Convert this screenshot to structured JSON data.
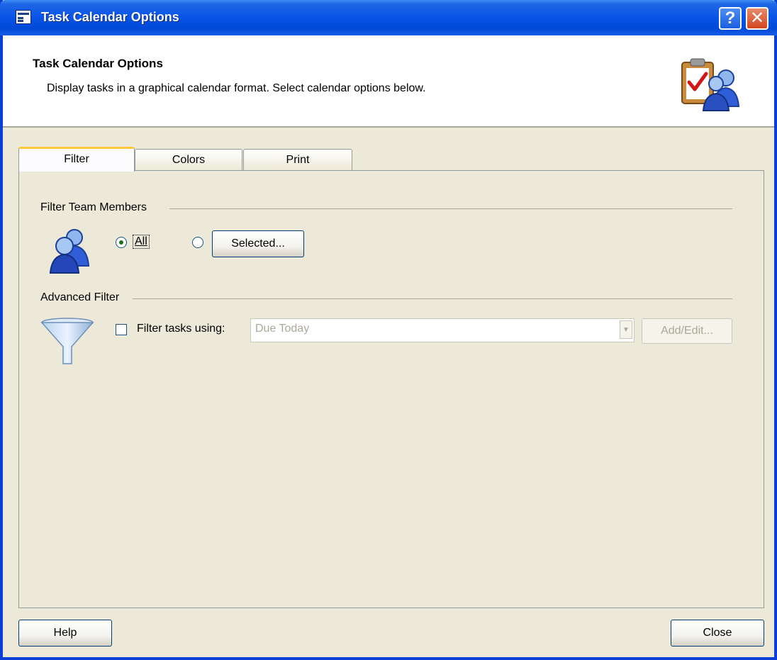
{
  "window": {
    "title": "Task Calendar Options",
    "help_button": "?",
    "close_button": "✕"
  },
  "header": {
    "title": "Task Calendar Options",
    "subtitle": "Display tasks in a graphical calendar format. Select calendar options below.",
    "icon": "clipboard-people-icon"
  },
  "tabs": [
    {
      "label": "Filter",
      "active": true
    },
    {
      "label": "Colors",
      "active": false
    },
    {
      "label": "Print",
      "active": false
    }
  ],
  "filter_team": {
    "label": "Filter Team Members",
    "icon": "team-members-icon",
    "option_all": "All",
    "option_all_selected": true,
    "option_selected_button": "Selected..."
  },
  "advanced_filter": {
    "label": "Advanced Filter",
    "icon": "funnel-icon",
    "checkbox_label": "Filter tasks using:",
    "checked": false,
    "combo_value": "Due Today",
    "add_edit_button": "Add/Edit..."
  },
  "footer": {
    "help_button": "Help",
    "close_button": "Close"
  },
  "colors": {
    "titlebar": "#0a56e8",
    "dialog_bg": "#ece9d8"
  }
}
